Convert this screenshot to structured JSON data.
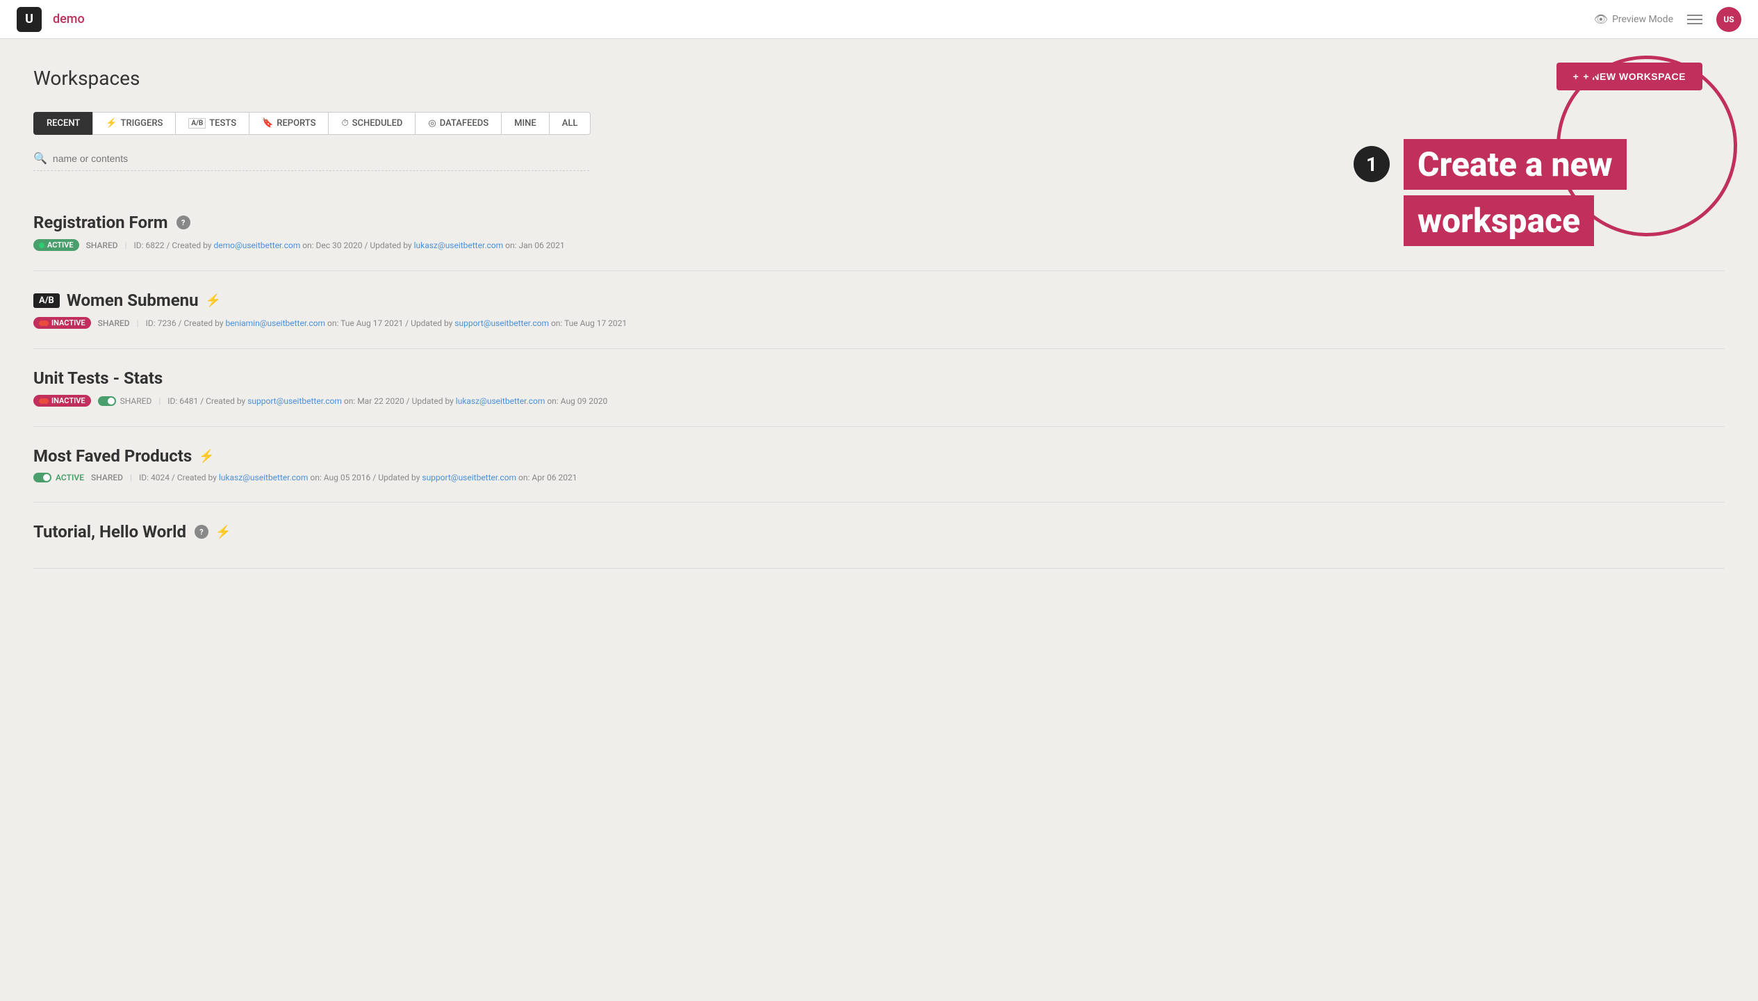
{
  "header": {
    "logo_text": "U",
    "brand": "demo",
    "preview_label": "Preview Mode",
    "user_initials": "US"
  },
  "page": {
    "title": "Workspaces",
    "new_workspace_btn": "+ NEW WORKSPACE"
  },
  "tabs": [
    {
      "id": "recent",
      "label": "RECENT",
      "icon": "",
      "active": true
    },
    {
      "id": "triggers",
      "label": "TRIGGERS",
      "icon": "⚡",
      "active": false
    },
    {
      "id": "tests",
      "label": "TESTS",
      "icon": "A/B",
      "active": false
    },
    {
      "id": "reports",
      "label": "REPORTS",
      "icon": "🔖",
      "active": false
    },
    {
      "id": "scheduled",
      "label": "SCHEDULED",
      "icon": "⏱",
      "active": false
    },
    {
      "id": "datafeeds",
      "label": "DATAFEEDS",
      "icon": "◎",
      "active": false
    },
    {
      "id": "mine",
      "label": "MINE",
      "icon": "",
      "active": false
    },
    {
      "id": "all",
      "label": "ALL",
      "icon": "",
      "active": false
    }
  ],
  "search": {
    "placeholder": "name or contents"
  },
  "callout": {
    "number": "1",
    "line1": "Create a new",
    "line2": "workspace"
  },
  "workspaces": [
    {
      "id": "registration-form",
      "name": "Registration Form",
      "has_question": true,
      "has_trigger": false,
      "ab": false,
      "status": "ACTIVE",
      "shared": "SHARED",
      "meta": "ID: 6822 / Created by demo@useitbetter.com on: Dec 30 2020 / Updated by lukasz@useitbetter.com on: Jan 06 2021"
    },
    {
      "id": "women-submenu",
      "name": "Women Submenu",
      "has_question": false,
      "has_trigger": true,
      "ab": true,
      "status": "INACTIVE",
      "shared": "SHARED",
      "meta": "ID: 7236 / Created by beniamin@useitbetter.com on: Tue Aug 17 2021 / Updated by support@useitbetter.com on: Tue Aug 17 2021"
    },
    {
      "id": "unit-tests-stats",
      "name": "Unit Tests - Stats",
      "has_question": false,
      "has_trigger": false,
      "ab": false,
      "status": "INACTIVE",
      "shared": "SHARED",
      "meta": "ID: 6481 / Created by support@useitbetter.com on: Mar 22 2020 / Updated by lukasz@useitbetter.com on: Aug 09 2020"
    },
    {
      "id": "most-faved-products",
      "name": "Most Faved Products",
      "has_question": false,
      "has_trigger": true,
      "ab": false,
      "status": "ACTIVE",
      "shared": "SHARED",
      "meta": "ID: 4024 / Created by lukasz@useitbetter.com on: Aug 05 2016 / Updated by support@useitbetter.com on: Apr 06 2021"
    },
    {
      "id": "tutorial-hello-world",
      "name": "Tutorial, Hello World",
      "has_question": true,
      "has_trigger": true,
      "ab": false,
      "status": null,
      "shared": null,
      "meta": ""
    }
  ]
}
